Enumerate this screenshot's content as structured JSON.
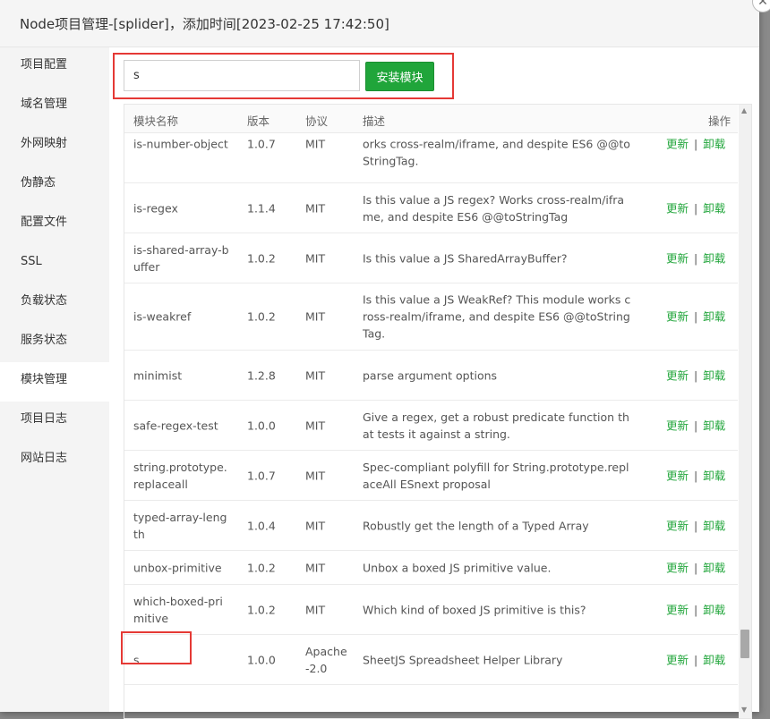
{
  "window": {
    "title": "Node项目管理-[splider]，添加时间[2023-02-25 17:42:50]",
    "close_glyph": "✕"
  },
  "sidebar": {
    "items": [
      {
        "label": "项目配置"
      },
      {
        "label": "域名管理"
      },
      {
        "label": "外网映射"
      },
      {
        "label": "伪静态"
      },
      {
        "label": "配置文件"
      },
      {
        "label": "SSL"
      },
      {
        "label": "负载状态"
      },
      {
        "label": "服务状态"
      },
      {
        "label": "模块管理"
      },
      {
        "label": "项目日志"
      },
      {
        "label": "网站日志"
      }
    ],
    "active_index": 8
  },
  "search": {
    "value": "s",
    "install_label": "安装模块"
  },
  "table": {
    "headers": {
      "name": "模块名称",
      "version": "版本",
      "license": "协议",
      "desc": "描述",
      "ops": "操作"
    },
    "ops": {
      "update": "更新",
      "separator": "|",
      "uninstall": "卸载"
    },
    "rows": [
      {
        "name": "is-number-object",
        "version": "1.0.7",
        "license": "MIT",
        "desc": "Is this value a JS Number object? This module works cross-realm/iframe, and despite ES6 @@toStringTag."
      },
      {
        "name": "is-regex",
        "version": "1.1.4",
        "license": "MIT",
        "desc": "Is this value a JS regex? Works cross-realm/iframe, and despite ES6 @@toStringTag"
      },
      {
        "name": "is-shared-array-buffer",
        "version": "1.0.2",
        "license": "MIT",
        "desc": "Is this value a JS SharedArrayBuffer?"
      },
      {
        "name": "is-weakref",
        "version": "1.0.2",
        "license": "MIT",
        "desc": "Is this value a JS WeakRef? This module works cross-realm/iframe, and despite ES6 @@toStringTag."
      },
      {
        "name": "minimist",
        "version": "1.2.8",
        "license": "MIT",
        "desc": "parse argument options"
      },
      {
        "name": "safe-regex-test",
        "version": "1.0.0",
        "license": "MIT",
        "desc": "Give a regex, get a robust predicate function that tests it against a string."
      },
      {
        "name": "string.prototype.replaceall",
        "version": "1.0.7",
        "license": "MIT",
        "desc": "Spec-compliant polyfill for String.prototype.replaceAll ESnext proposal"
      },
      {
        "name": "typed-array-length",
        "version": "1.0.4",
        "license": "MIT",
        "desc": "Robustly get the length of a Typed Array"
      },
      {
        "name": "unbox-primitive",
        "version": "1.0.2",
        "license": "MIT",
        "desc": "Unbox a boxed JS primitive value."
      },
      {
        "name": "which-boxed-primitive",
        "version": "1.0.2",
        "license": "MIT",
        "desc": "Which kind of boxed JS primitive is this?"
      },
      {
        "name": "s",
        "version": "1.0.0",
        "license": "Apache-2.0",
        "desc": "SheetJS Spreadsheet Helper Library"
      }
    ]
  },
  "scrollbar": {
    "up_glyph": "▲",
    "down_glyph": "▼"
  },
  "colors": {
    "accent_green": "#20a53a",
    "highlight_red": "#e53935"
  }
}
